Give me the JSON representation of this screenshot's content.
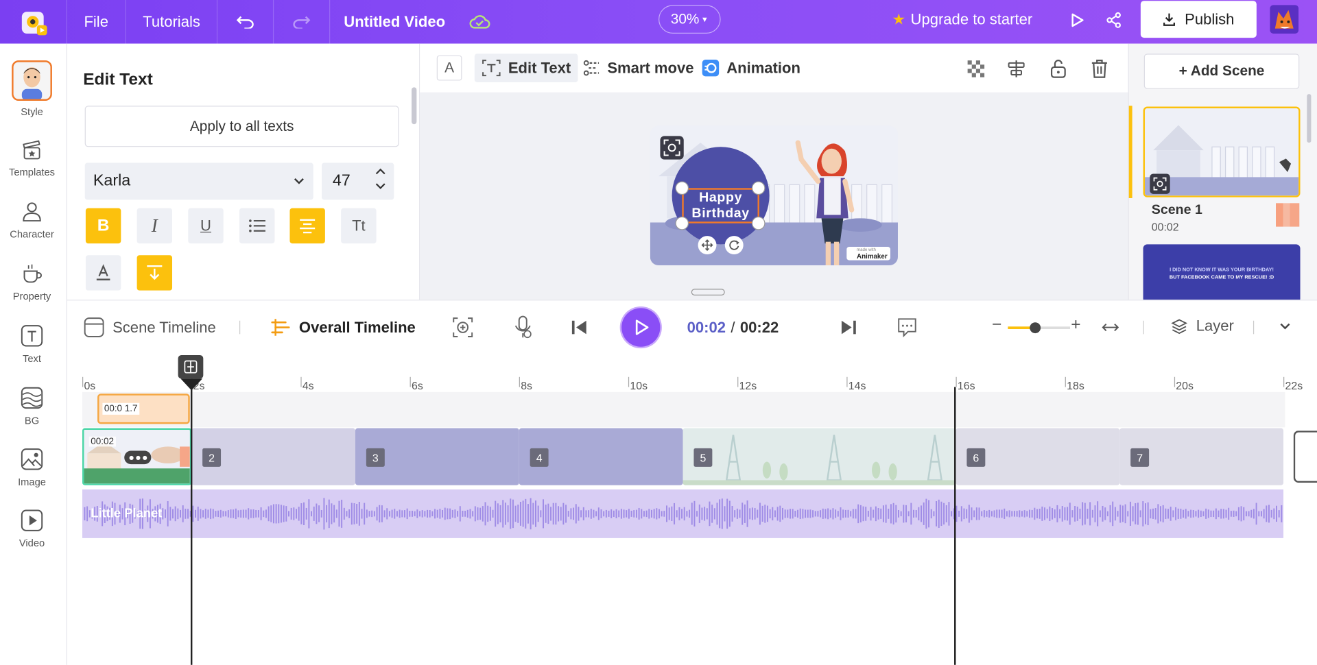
{
  "topbar": {
    "menu": [
      "File",
      "Tutorials"
    ],
    "title": "Untitled Video",
    "zoom": "30%",
    "upgrade": "Upgrade to starter",
    "publish": "Publish"
  },
  "rail": [
    "Style",
    "Templates",
    "Character",
    "Property",
    "Text",
    "BG",
    "Image",
    "Video"
  ],
  "panel": {
    "title": "Edit Text",
    "apply_all": "Apply to all texts",
    "font": "Karla",
    "size": "47",
    "bold_label": "B",
    "italic_label": "I",
    "underline_label": "U",
    "tt_label": "Tt"
  },
  "toolbar": {
    "text_icon_label": "A",
    "edit_text": "Edit Text",
    "smart_move": "Smart move",
    "animation": "Animation"
  },
  "canvas": {
    "text_line1": "Happy",
    "text_line2": "Birthday",
    "watermark": "Animaker",
    "watermark_small": "made with"
  },
  "scenes_panel": {
    "add_scene": "+ Add Scene",
    "scene1_title": "Scene 1",
    "scene1_time": "00:02",
    "scene2_line1": "I DID NOT KNOW IT WAS YOUR BIRTHDAY!",
    "scene2_line2": "BUT FACEBOOK CAME TO MY RESCUE! :D"
  },
  "timeline": {
    "scene_timeline": "Scene Timeline",
    "overall_timeline": "Overall Timeline",
    "current": "00:02",
    "separator": "/",
    "total": "00:22",
    "layer": "Layer",
    "ruler": [
      "0s",
      "2s",
      "4s",
      "6s",
      "8s",
      "10s",
      "12s",
      "14s",
      "16s",
      "18s",
      "20s",
      "22s"
    ],
    "element_label": "00:0 1.7",
    "scene1_time": "00:02",
    "scene_numbers": [
      "2",
      "3",
      "4",
      "5",
      "6",
      "7"
    ],
    "audio_track": "Little Planet"
  },
  "colors": {
    "brand_purple": "#7b3ff2",
    "accent_yellow": "#fcc10d",
    "play_purple": "#8a4ef6"
  }
}
